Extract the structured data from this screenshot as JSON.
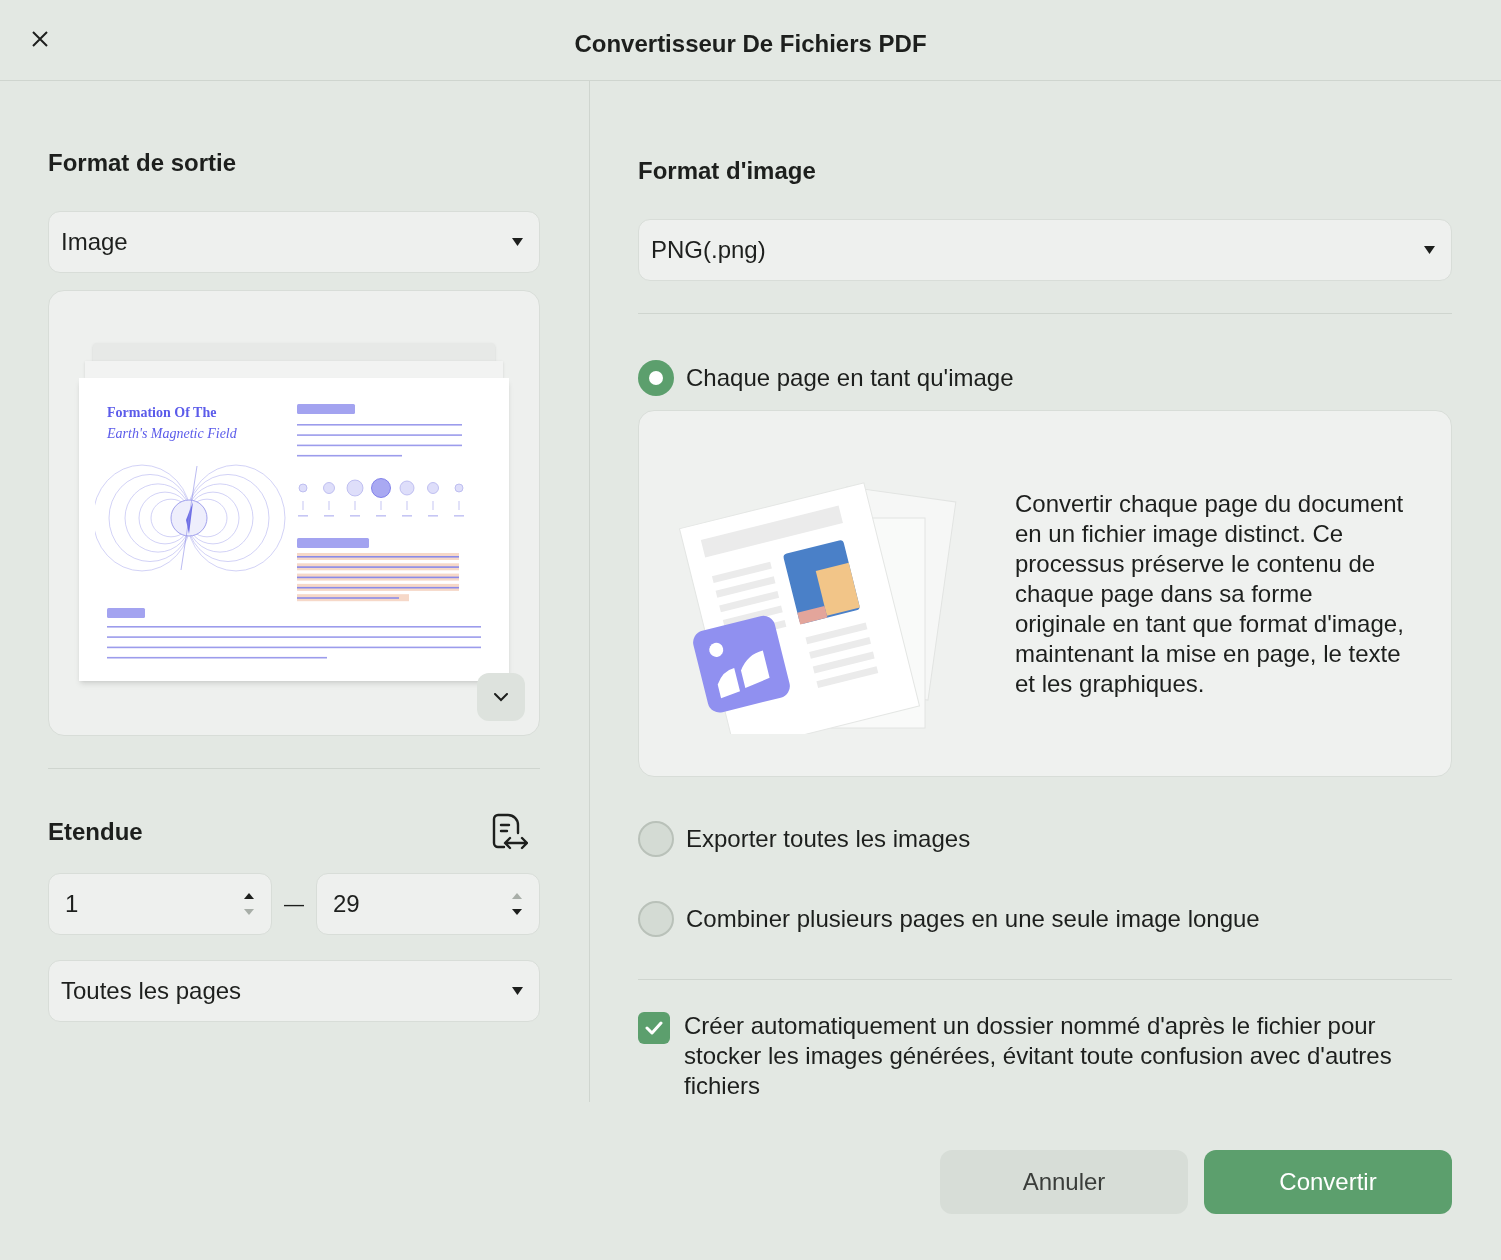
{
  "window": {
    "title": "Convertisseur De Fichiers PDF"
  },
  "output_format": {
    "label": "Format de sortie",
    "value": "Image"
  },
  "preview": {
    "title_line_1": "Formation Of The",
    "title_line_2": "Earth's Magnetic Field"
  },
  "range": {
    "label": "Etendue",
    "from": {
      "value": "1",
      "up_disabled": false,
      "down_disabled": true
    },
    "separator": "—",
    "to": {
      "value": "29",
      "up_disabled": true,
      "down_disabled": false
    },
    "pages": "Toutes les pages"
  },
  "image_format": {
    "label": "Format d'image",
    "value": "PNG(.png)"
  },
  "options": [
    {
      "label": "Chaque page en tant qu'image",
      "selected": true,
      "description": "Convertir chaque page du document en un fichier image distinct. Ce processus préserve le contenu de chaque page dans sa forme originale en tant que format d'image, maintenant la mise en page, le texte et les graphiques."
    },
    {
      "label": "Exporter toutes les images",
      "selected": false
    },
    {
      "label": "Combiner plusieurs pages en une seule image longue",
      "selected": false
    }
  ],
  "auto_folder": {
    "label": "Créer automatiquement un dossier nommé d'après le fichier pour stocker les images générées, évitant toute confusion avec d'autres fichiers",
    "checked": true
  },
  "buttons": [
    {
      "label": "Annuler",
      "kind": "secondary"
    },
    {
      "label": "Convertir",
      "kind": "primary"
    }
  ]
}
